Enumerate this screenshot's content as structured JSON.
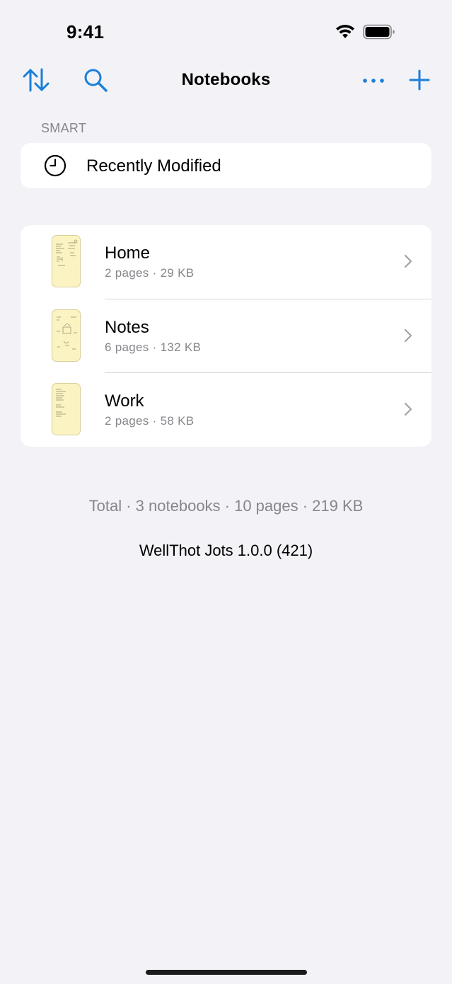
{
  "status_bar": {
    "time": "9:41",
    "icons": [
      "wifi-icon",
      "battery-icon"
    ]
  },
  "nav": {
    "title": "Notebooks",
    "left_actions": [
      "sort-icon",
      "search-icon"
    ],
    "right_actions": [
      "more-icon",
      "plus-icon"
    ],
    "accent_color": "#1a7fd9"
  },
  "smart_section": {
    "header": "SMART",
    "items": [
      {
        "label": "Recently Modified",
        "icon": "clock-icon"
      }
    ]
  },
  "notebooks": [
    {
      "title": "Home",
      "subtitle": "2 pages · 29 KB",
      "thumbnail_color": "#fbf3c1"
    },
    {
      "title": "Notes",
      "subtitle": "6 pages · 132 KB",
      "thumbnail_color": "#fbf3c1"
    },
    {
      "title": "Work",
      "subtitle": "2 pages · 58 KB",
      "thumbnail_color": "#fbf3c1"
    }
  ],
  "footer": {
    "total": "Total · 3 notebooks · 10 pages · 219 KB",
    "version": "WellThot Jots 1.0.0 (421)"
  },
  "colors": {
    "background": "#f2f2f7",
    "card": "#ffffff",
    "secondary_text": "#86868b",
    "accent": "#1a7fd9"
  }
}
